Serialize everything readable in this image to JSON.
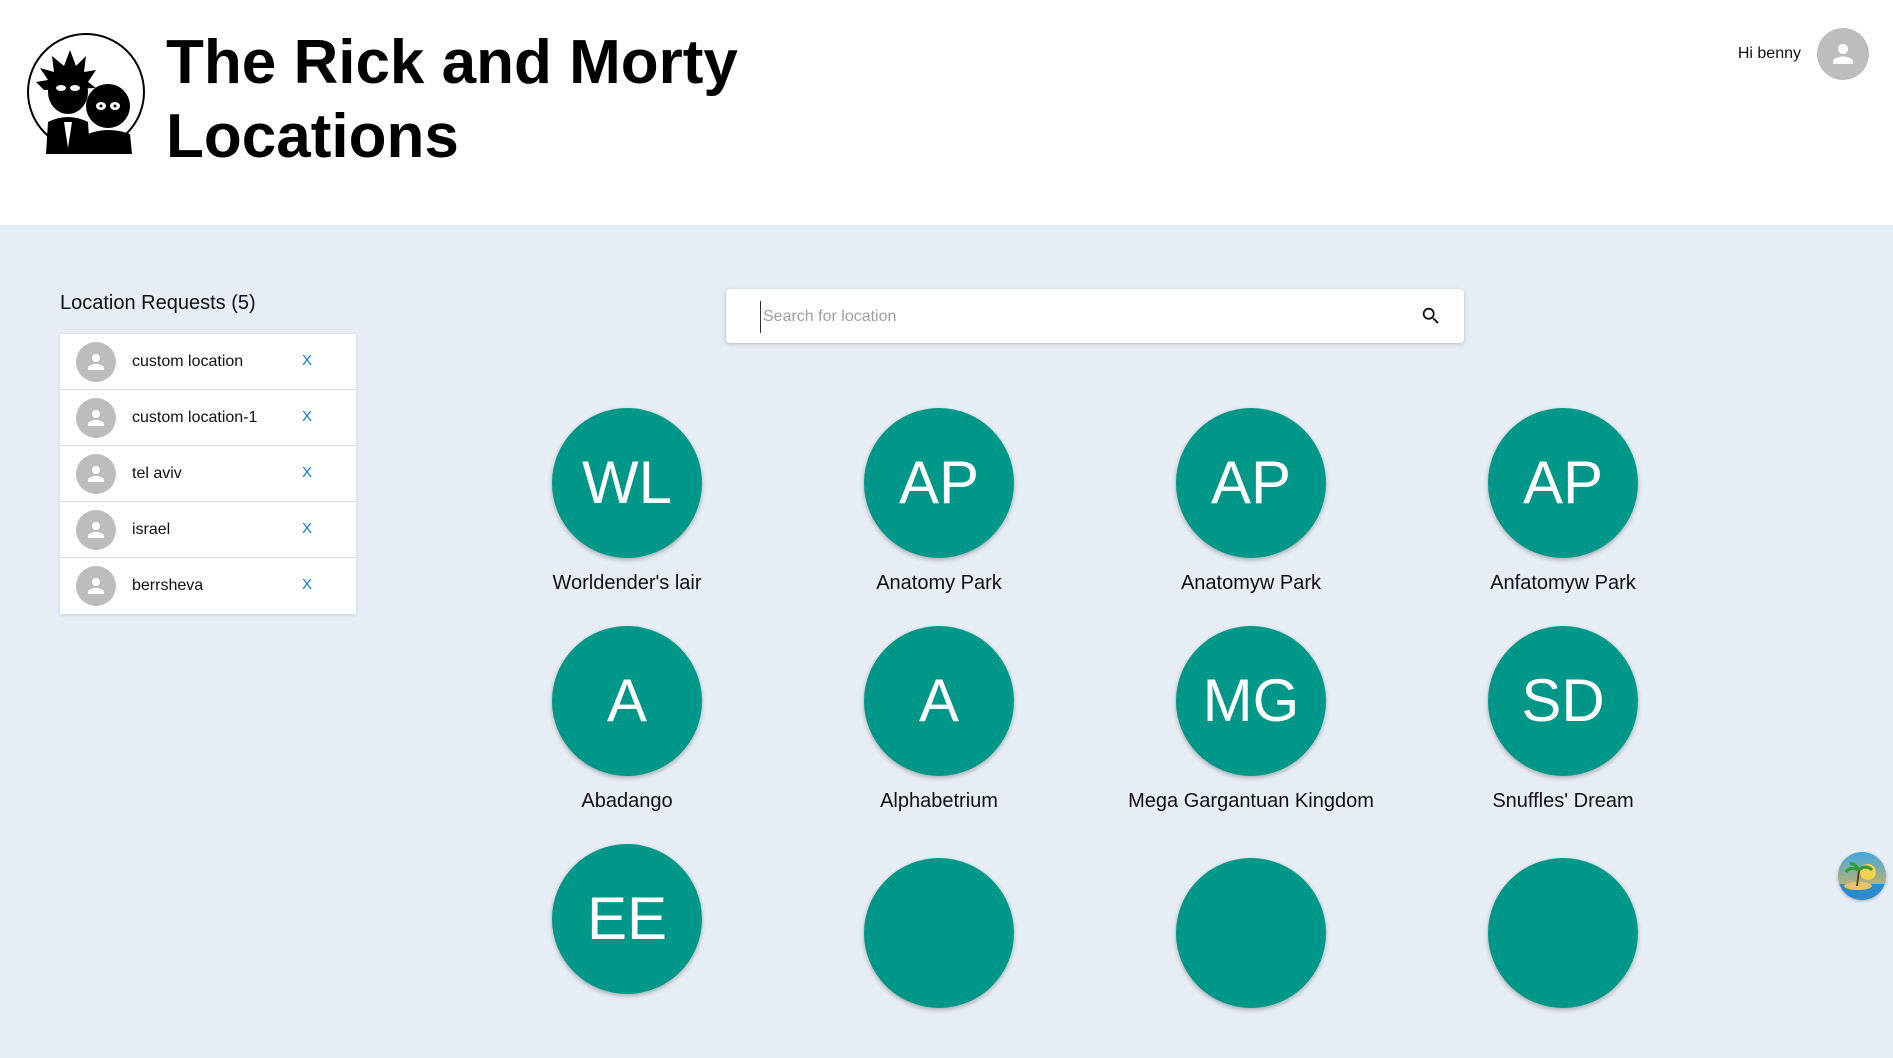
{
  "header": {
    "title": "The Rick and Morty Locations",
    "greeting": "Hi benny"
  },
  "sidebar": {
    "heading": "Location Requests (5)",
    "remove_label": "X",
    "requests": [
      {
        "label": "custom location"
      },
      {
        "label": "custom location-1"
      },
      {
        "label": "tel aviv"
      },
      {
        "label": "israel"
      },
      {
        "label": "berrsheva"
      }
    ]
  },
  "search": {
    "placeholder": "Search for location",
    "value": ""
  },
  "locations": [
    {
      "initials": "WL",
      "name": "Worldender's lair"
    },
    {
      "initials": "AP",
      "name": "Anatomy Park"
    },
    {
      "initials": "AP",
      "name": "Anatomyw Park"
    },
    {
      "initials": "AP",
      "name": "Anfatomyw Park"
    },
    {
      "initials": "A",
      "name": "Abadango"
    },
    {
      "initials": "A",
      "name": "Alphabetrium"
    },
    {
      "initials": "MG",
      "name": "Mega Gargantuan Kingdom"
    },
    {
      "initials": "SD",
      "name": "Snuffles' Dream"
    },
    {
      "initials": "EE",
      "name": ""
    },
    {
      "initials": "",
      "name": ""
    },
    {
      "initials": "",
      "name": ""
    },
    {
      "initials": "",
      "name": ""
    }
  ],
  "colors": {
    "page_bg": "#e6edf4",
    "header_bg": "#ffffff",
    "location_avatar": "#009688",
    "remove_link": "#1976d2",
    "user_avatar": "#bdbdbd"
  },
  "icons": {
    "logo": "rick-and-morty-logo",
    "user": "account-icon",
    "search": "search-icon",
    "corner": "island-icon"
  }
}
